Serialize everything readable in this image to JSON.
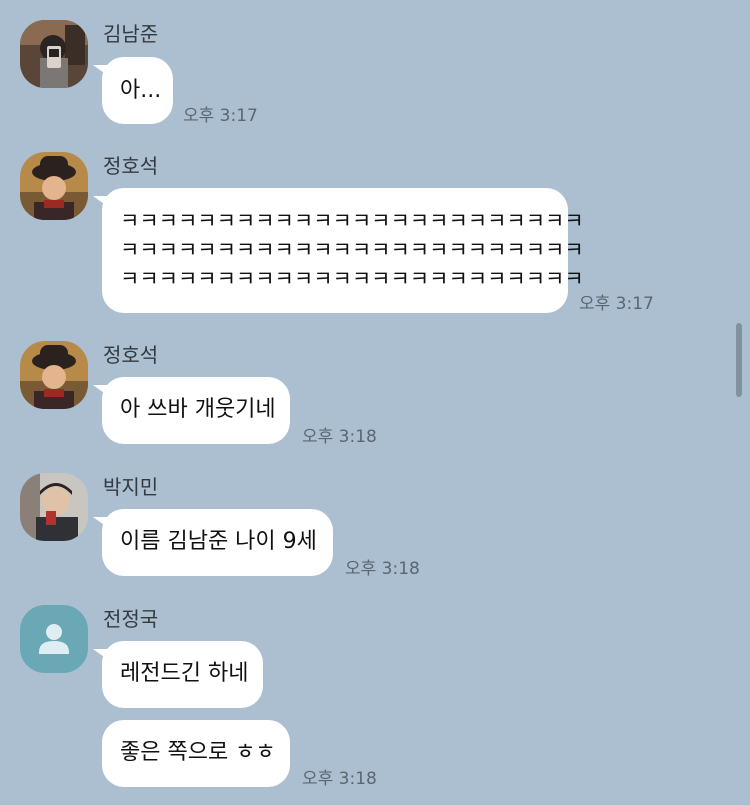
{
  "colors": {
    "background": "#abbfd1",
    "bubble": "#ffffff",
    "default_avatar": "#6aa8b6"
  },
  "messages": [
    {
      "sender": "김남준",
      "avatar": "photo-avatar",
      "bubbles": [
        "아..."
      ],
      "time": "오후 3:17"
    },
    {
      "sender": "정호석",
      "avatar": "photo-avatar",
      "bubbles": [
        "ㅋㅋㅋㅋㅋㅋㅋㅋㅋㅋㅋㅋㅋㅋㅋㅋㅋㅋㅋㅋㅋㅋㅋㅋ\nㅋㅋㅋㅋㅋㅋㅋㅋㅋㅋㅋㅋㅋㅋㅋㅋㅋㅋㅋㅋㅋㅋㅋㅋ\nㅋㅋㅋㅋㅋㅋㅋㅋㅋㅋㅋㅋㅋㅋㅋㅋㅋㅋㅋㅋㅋㅋㅋㅋ"
      ],
      "time": "오후 3:17"
    },
    {
      "sender": "정호석",
      "avatar": "photo-avatar",
      "bubbles": [
        "아 쓰바 개웃기네"
      ],
      "time": "오후 3:18"
    },
    {
      "sender": "박지민",
      "avatar": "photo-avatar",
      "bubbles": [
        "이름 김남준 나이 9세"
      ],
      "time": "오후 3:18"
    },
    {
      "sender": "전정국",
      "avatar": "default-person-avatar",
      "bubbles": [
        "레전드긴 하네",
        "좋은 쪽으로 ㅎㅎ"
      ],
      "time": "오후 3:18"
    }
  ]
}
